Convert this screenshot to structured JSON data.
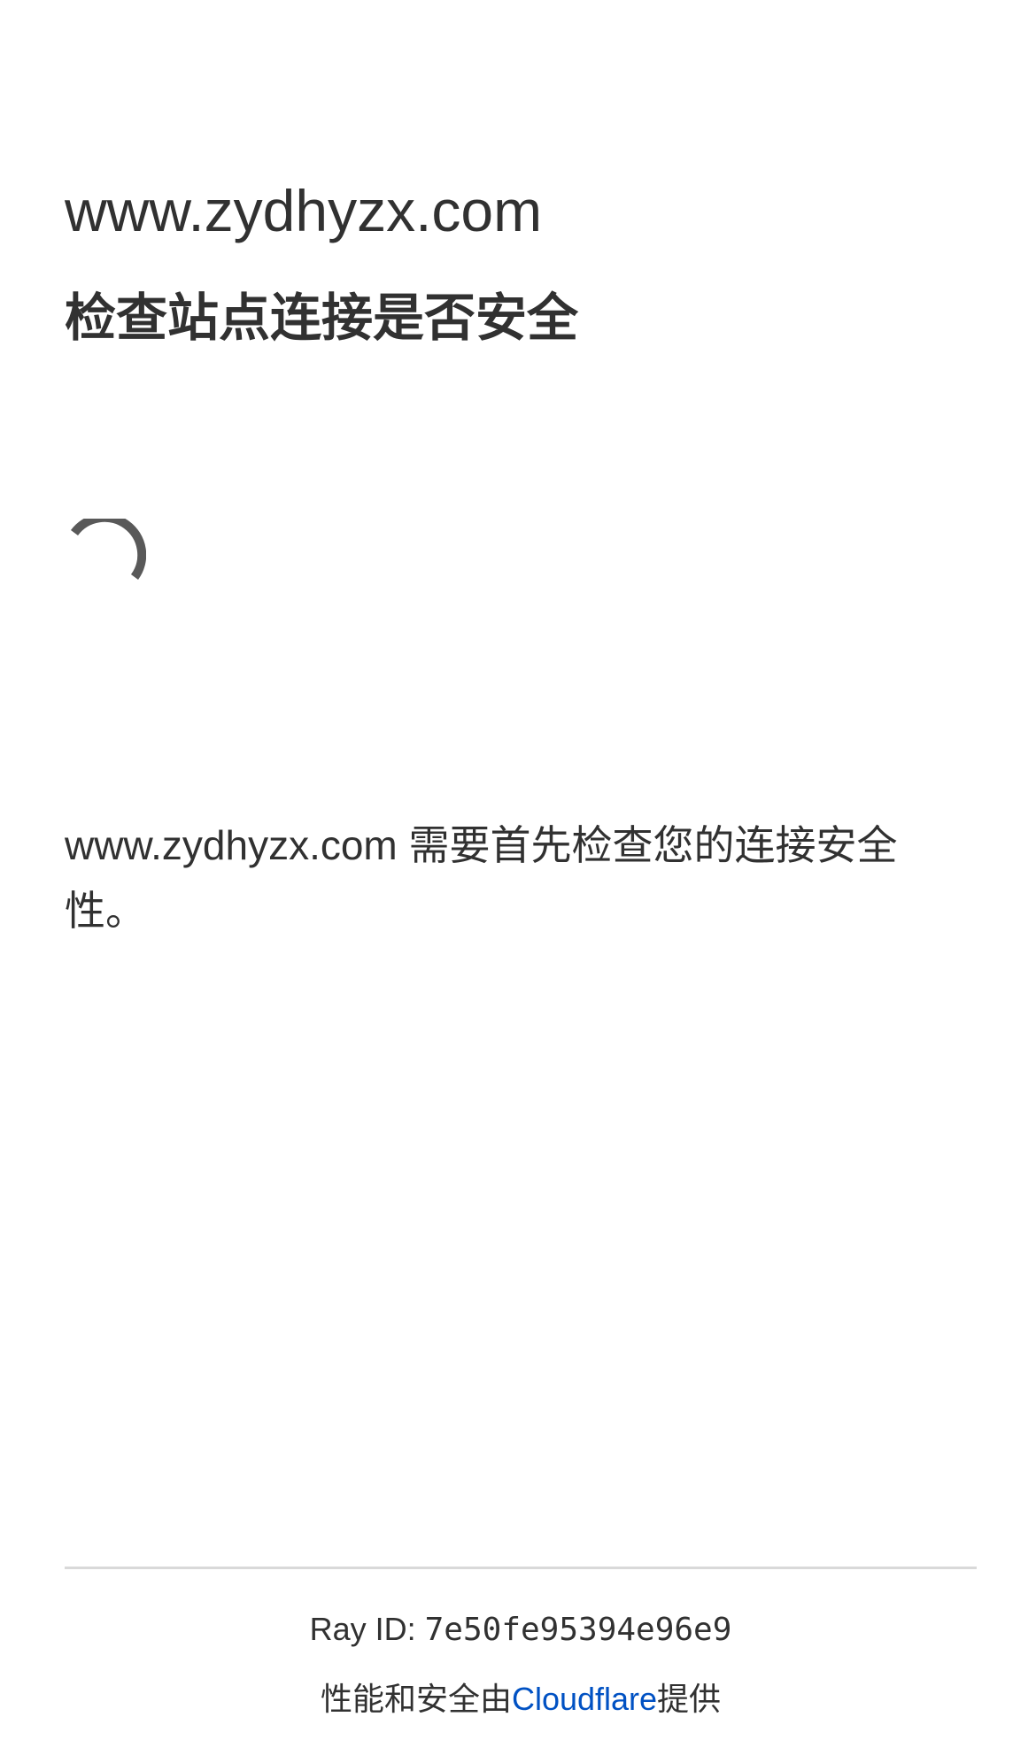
{
  "challenge": {
    "site_name": "www.zydhyzx.com",
    "heading": "检查站点连接是否安全",
    "message": "www.zydhyzx.com 需要首先检查您的连接安全性。"
  },
  "footer": {
    "ray_label": "Ray ID: ",
    "ray_id": "7e50fe95394e96e9",
    "performance_prefix": "性能和安全由",
    "provider_link": "Cloudflare",
    "performance_suffix": "提供"
  },
  "colors": {
    "text": "#313131",
    "link": "#0051c3",
    "spinner": "#595959",
    "divider": "#d9d9d9"
  },
  "icons": {
    "spinner": "loading-spinner-icon"
  }
}
